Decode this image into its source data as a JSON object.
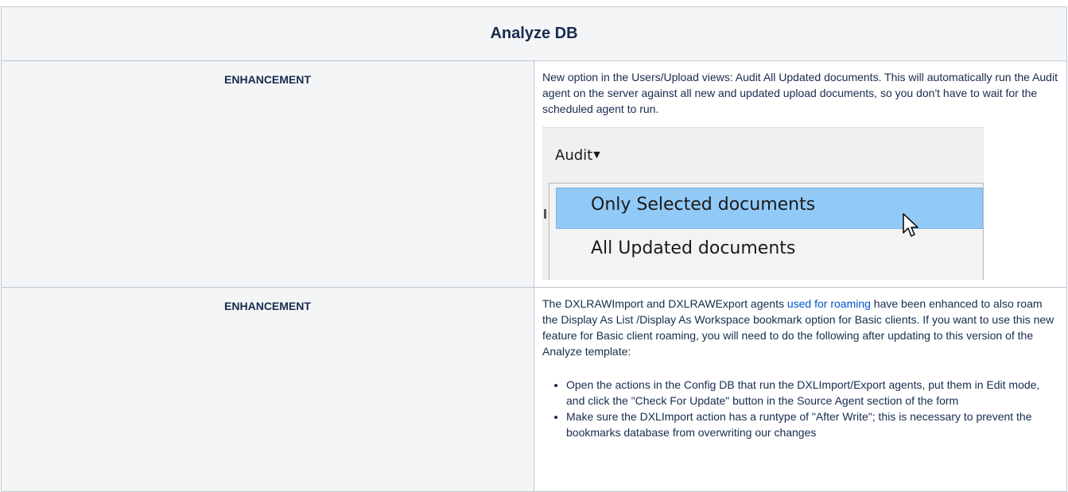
{
  "page": {
    "title": "Analyze DB"
  },
  "rows": [
    {
      "type": "ENHANCEMENT",
      "description": "New option in the Users/Upload views: Audit All Updated documents. This will automatically run the Audit agent on the server against all new and updated upload documents, so you don't have to wait for the scheduled agent to run.",
      "screenshot": {
        "menu_button": "Audit",
        "menu_items": [
          {
            "label": "Only Selected documents",
            "selected": true
          },
          {
            "label": "All Updated documents",
            "selected": false
          }
        ],
        "highlight_color": "#91c9f7"
      }
    },
    {
      "type": "ENHANCEMENT",
      "text_before_link": "The DXLRAWImport and DXLRAWExport agents ",
      "link_text": "used for roaming",
      "text_after_link": " have been enhanced to also roam the Display As List /Display As Workspace bookmark option for Basic clients. If you want to use this new feature for Basic client roaming, you will need to do the following after updating to this version of the Analyze template:",
      "bullets": [
        "Open the actions in the Config DB that run the DXLImport/Export agents, put them in Edit mode, and click the \"Check For Update\" button in the Source Agent section of the form",
        "Make sure the DXLImport action has a runtype of \"After Write\"; this is necessary to prevent the bookmarks database from overwriting our changes"
      ]
    }
  ],
  "colors": {
    "header_bg": "#f4f5f7",
    "border": "#c1c7d0",
    "text": "#172b4d",
    "link": "#0052cc"
  }
}
